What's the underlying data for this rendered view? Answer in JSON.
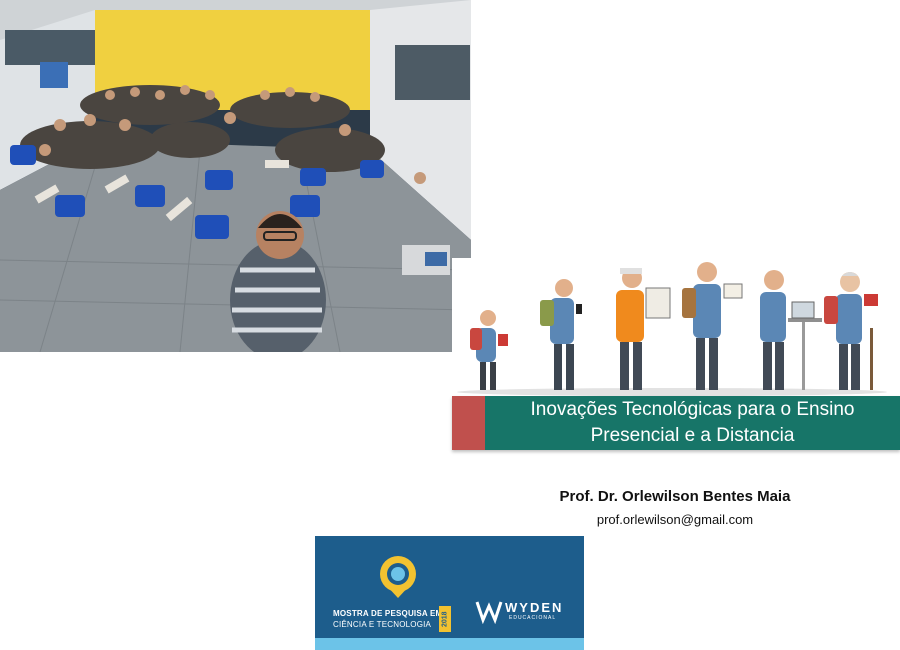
{
  "images": {
    "classroom_photo": "classroom-group-selfie-photo",
    "evolution_illustration": "human-evolution-reading-devices-illustration"
  },
  "title": {
    "line1": "Inovações Tecnológicas para o Ensino",
    "line2": "Presencial e a Distancia"
  },
  "author": {
    "name": "Prof. Dr. Orlewilson Bentes Maia",
    "email": "prof.orlewilson@gmail.com"
  },
  "logo": {
    "event_line1": "MOSTRA DE PESQUISA EM",
    "event_line2": "CIÊNCIA E TECNOLOGIA",
    "year": "2018",
    "brand": "WYDEN",
    "brand_sub": "EDUCACIONAL"
  },
  "colors": {
    "banner_accent": "#c0504d",
    "banner_main": "#177568",
    "logo_bg": "#1d5d8c",
    "logo_stripe": "#6cc3e8",
    "logo_pin": "#f2c230"
  }
}
